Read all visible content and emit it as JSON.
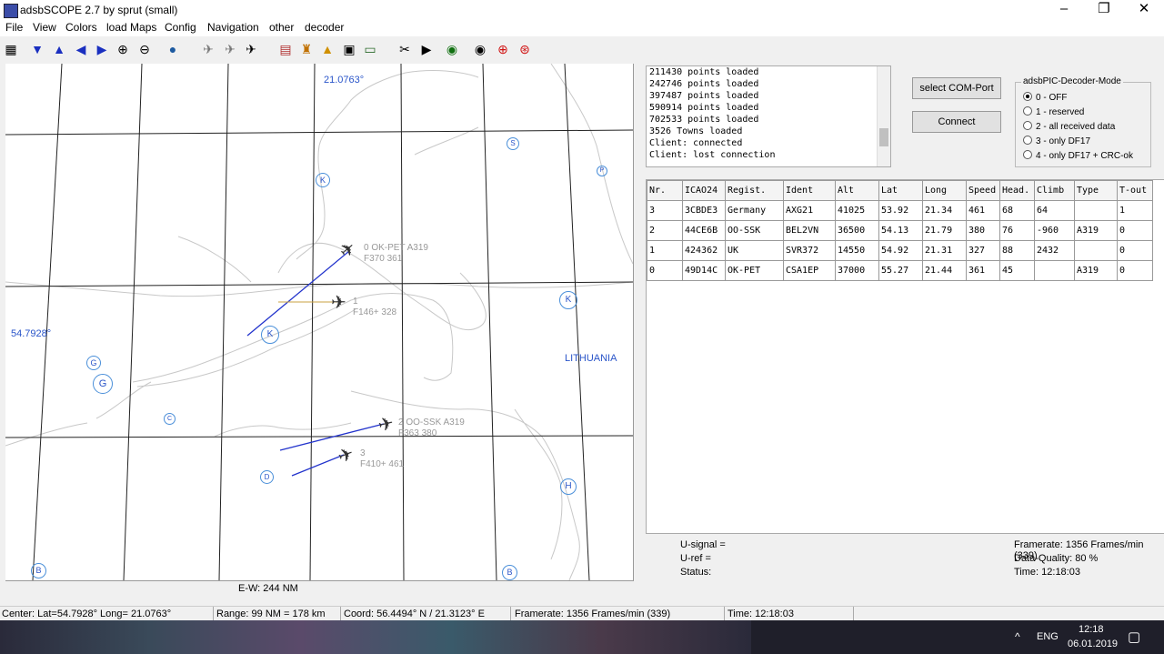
{
  "window": {
    "title": "adsbSCOPE 2.7 by sprut  (small)",
    "min_icon": "minimize-icon",
    "max_icon": "maximize-icon",
    "close_icon": "close-icon"
  },
  "menu": [
    "File",
    "View",
    "Colors",
    "load Maps",
    "Config",
    "Navigation",
    "other",
    "decoder"
  ],
  "map": {
    "top_coord": "21.0763°",
    "left_coord": "54.7928°",
    "country_label": "LITHUANIA",
    "scale_label": "E-W: 244 NM",
    "aircraft": [
      {
        "line1": "0  OK-PET  A319",
        "line2": "F370   361"
      },
      {
        "line1": "1",
        "line2": "F146+  328"
      },
      {
        "line1": "2  OO-SSK  A319",
        "line2": "F363   380"
      },
      {
        "line1": "3",
        "line2": "F410+  461"
      }
    ],
    "beacon_letters": [
      "S",
      "P",
      "K",
      "K",
      "K",
      "G",
      "G",
      "G",
      "C",
      "D",
      "H",
      "B",
      "B"
    ]
  },
  "log": [
    "211430 points loaded",
    "242746 points loaded",
    "397487 points loaded",
    "590914 points loaded",
    "702533 points loaded",
    "3526 Towns loaded",
    "Client: connected",
    "Client: lost connection"
  ],
  "controls": {
    "select_com_label": "select COM-Port",
    "connect_label": "Connect",
    "mode_group_label": "adsbPIC-Decoder-Mode",
    "modes": [
      "0 - OFF",
      "1 - reserved",
      "2 - all received data",
      "3 - only DF17",
      "4 - only DF17 + CRC-ok"
    ],
    "selected_mode": 0
  },
  "table": {
    "headers": [
      "Nr.",
      "ICAO24",
      "Regist.",
      "Ident",
      "Alt",
      "Lat",
      "Long",
      "Speed",
      "Head.",
      "Climb",
      "Type",
      "T-out"
    ],
    "rows": [
      [
        "3",
        "3CBDE3",
        "Germany",
        "AXG21",
        "41025",
        "53.92",
        "21.34",
        "461",
        "68",
        "64",
        "",
        "1"
      ],
      [
        "2",
        "44CE6B",
        "OO-SSK",
        "BEL2VN",
        "36500",
        "54.13",
        "21.79",
        "380",
        "76",
        "-960",
        "A319",
        "0"
      ],
      [
        "1",
        "424362",
        "UK",
        "SVR372",
        "14550",
        "54.92",
        "21.31",
        "327",
        "88",
        "2432",
        "",
        "0"
      ],
      [
        "0",
        "49D14C",
        "OK-PET",
        "CSA1EP",
        "37000",
        "55.27",
        "21.44",
        "361",
        "45",
        "",
        "A319",
        "0"
      ]
    ]
  },
  "status_panel": {
    "u_signal": "U-signal =",
    "u_ref": "U-ref =",
    "status": "Status:",
    "framerate": "Framerate:  1356 Frames/min (339)",
    "quality": "Data-Quality: 80 %",
    "time": "Time: 12:18:03"
  },
  "statusbar": {
    "center": "Center: Lat=54.7928° Long= 21.0763°",
    "range": "Range: 99 NM = 178 km",
    "coord": "Coord: 56.4494° N / 21.3123° E",
    "framerate": "Framerate:  1356 Frames/min (339)",
    "time": "Time: 12:18:03"
  },
  "taskbar": {
    "lang": "ENG",
    "clock_time": "12:18",
    "clock_date": "06.01.2019"
  },
  "colors": {
    "track": "#2233cc",
    "map_lines": "#c8c8c8",
    "grid": "#222222",
    "beacon": "#4a8fd9"
  }
}
